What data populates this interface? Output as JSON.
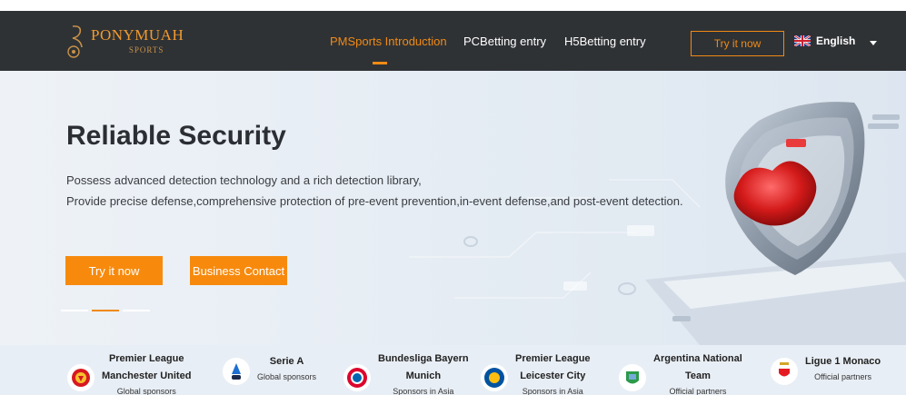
{
  "brand": {
    "name": "PONYMUAH",
    "sub": "SPORTS",
    "colors": {
      "accent": "#f08a14",
      "nav_bg": "#2f3235",
      "button": "#f78a0d"
    }
  },
  "nav": {
    "items": [
      {
        "label": "PMSports Introduction",
        "active": true
      },
      {
        "label": "PCBetting entry",
        "active": false
      },
      {
        "label": "H5Betting entry",
        "active": false
      }
    ],
    "try_label": "Try it now",
    "language": "English"
  },
  "hero": {
    "title": "Reliable Security",
    "line1": "Possess advanced detection technology and a rich detection library,",
    "line2": "Provide precise defense,comprehensive protection of pre-event prevention,in-event defense,and post-event detection.",
    "primary_button": "Try it now",
    "secondary_button": "Business Contact",
    "carousel": {
      "slides": 3,
      "active_index": 1
    }
  },
  "sponsors": [
    {
      "line1": "Premier League",
      "line2": "Manchester United",
      "line3": "Global sponsors",
      "icon": "manchester-united-crest-icon"
    },
    {
      "line1": "",
      "line2": "Serie A",
      "line3": "Global sponsors",
      "icon": "serie-a-logo-icon"
    },
    {
      "line1": "Bundesliga Bayern",
      "line2": "Munich",
      "line3": "Sponsors in Asia",
      "icon": "bayern-munich-crest-icon"
    },
    {
      "line1": "Premier League",
      "line2": "Leicester City",
      "line3": "Sponsors in Asia",
      "icon": "leicester-city-crest-icon"
    },
    {
      "line1": "Argentina National",
      "line2": "Team",
      "line3": "Official partners",
      "icon": "argentina-afa-crest-icon"
    },
    {
      "line1": "",
      "line2": "Ligue 1 Monaco",
      "line3": "Official partners",
      "icon": "monaco-crest-icon"
    }
  ]
}
